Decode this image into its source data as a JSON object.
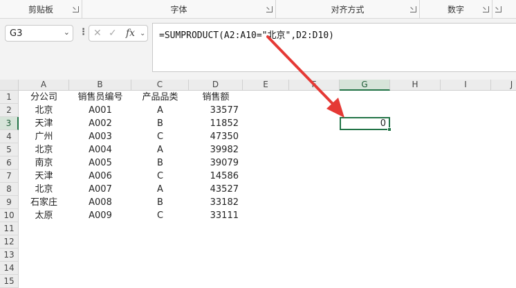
{
  "ribbon": {
    "groups": [
      {
        "label": "剪贴板"
      },
      {
        "label": "字体"
      },
      {
        "label": "对齐方式"
      },
      {
        "label": "数字"
      }
    ]
  },
  "namebox": {
    "value": "G3"
  },
  "formula": {
    "text": "=SUMPRODUCT(A2:A10=\"北京\",D2:D10)",
    "fx_label": "fx"
  },
  "columns": [
    "A",
    "B",
    "C",
    "D",
    "E",
    "F",
    "G",
    "H",
    "I",
    "J"
  ],
  "rows": [
    "1",
    "2",
    "3",
    "4",
    "5",
    "6",
    "7",
    "8",
    "9",
    "10",
    "11",
    "12",
    "13",
    "14",
    "15"
  ],
  "table": {
    "headers": [
      "分公司",
      "销售员编号",
      "产品品类",
      "销售额"
    ],
    "data": [
      [
        "北京",
        "A001",
        "A",
        "33577"
      ],
      [
        "天津",
        "A002",
        "B",
        "11852"
      ],
      [
        "广州",
        "A003",
        "C",
        "47350"
      ],
      [
        "北京",
        "A004",
        "A",
        "39982"
      ],
      [
        "南京",
        "A005",
        "B",
        "39079"
      ],
      [
        "天津",
        "A006",
        "C",
        "14586"
      ],
      [
        "北京",
        "A007",
        "A",
        "43527"
      ],
      [
        "石家庄",
        "A008",
        "B",
        "33182"
      ],
      [
        "太原",
        "A009",
        "C",
        "33111"
      ]
    ]
  },
  "result_cell": {
    "value": "0"
  },
  "colors": {
    "accent": "#217346",
    "arrow": "#e53935"
  }
}
